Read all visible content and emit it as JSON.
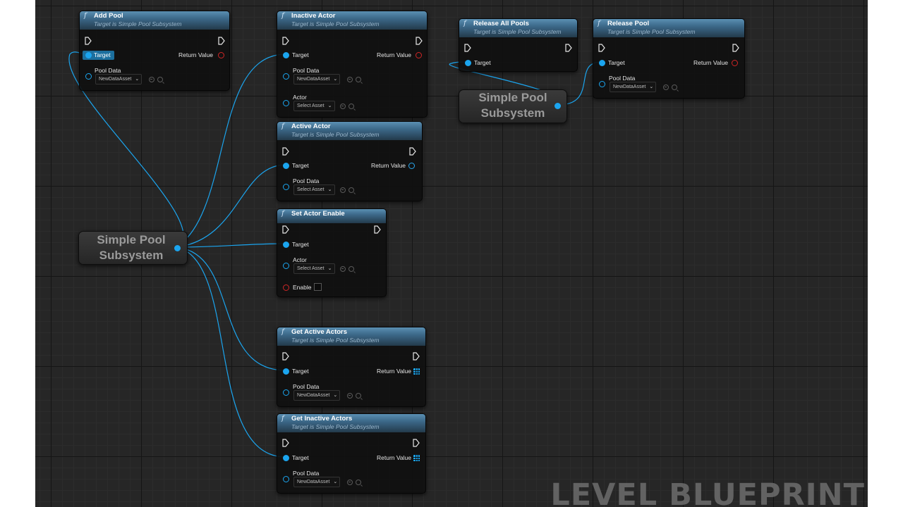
{
  "watermark": "LEVEL BLUEPRINT",
  "variable_label": "Simple Pool Subsystem",
  "labels": {
    "target": "Target",
    "pool_data": "Pool Data",
    "actor": "Actor",
    "return_value": "Return Value",
    "enable": "Enable"
  },
  "nodes": {
    "add_pool": {
      "title": "Add Pool",
      "subtitle": "Target is Simple Pool Subsystem",
      "pool_data_value": "NewDataAsset"
    },
    "inactive_actor": {
      "title": "Inactive Actor",
      "subtitle": "Target is Simple Pool Subsystem",
      "pool_data_value": "NewDataAsset",
      "actor_value": "Select Asset"
    },
    "active_actor": {
      "title": "Active Actor",
      "subtitle": "Target is Simple Pool Subsystem",
      "pool_data_value": "Select Asset"
    },
    "set_actor_enable": {
      "title": "Set Actor Enable",
      "actor_value": "Select Asset"
    },
    "get_active_actors": {
      "title": "Get Active Actors",
      "subtitle": "Target is Simple Pool Subsystem",
      "pool_data_value": "NewDataAsset"
    },
    "get_inactive_actors": {
      "title": "Get Inactive Actors",
      "subtitle": "Target is Simple Pool Subsystem",
      "pool_data_value": "NewDataAsset"
    },
    "release_all_pools": {
      "title": "Release All Pools",
      "subtitle": "Target is Simple Pool Subsystem"
    },
    "release_pool": {
      "title": "Release Pool",
      "subtitle": "Target is Simple Pool Subsystem",
      "pool_data_value": "NewDataAsset"
    }
  },
  "colors": {
    "wire": "#1ba5ef",
    "object_pin": "#1ba5ef",
    "bool_pin": "#d02626",
    "graph_background": "#262626",
    "node_header": "#3d6a8b"
  }
}
